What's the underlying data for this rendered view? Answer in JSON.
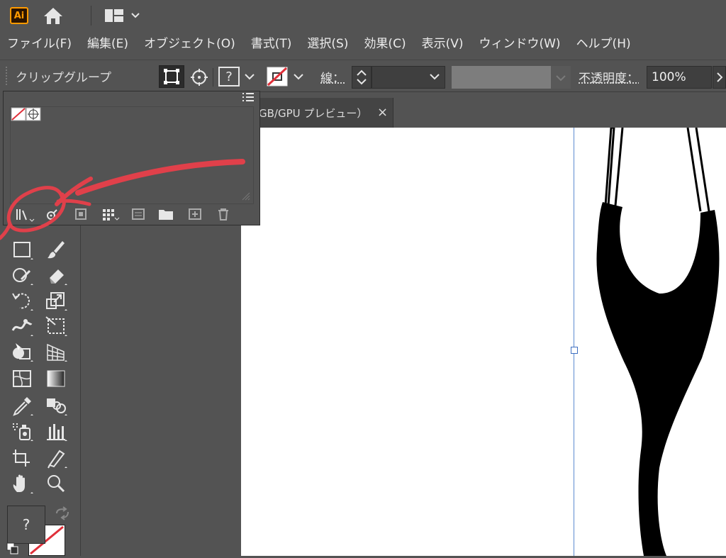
{
  "app": {
    "logo_text": "Ai",
    "accent": "#ff9a00"
  },
  "menu": {
    "items": [
      "ファイル(F)",
      "編集(E)",
      "オブジェクト(O)",
      "書式(T)",
      "選択(S)",
      "効果(C)",
      "表示(V)",
      "ウィンドウ(W)",
      "ヘルプ(H)"
    ]
  },
  "control": {
    "selection_label": "クリップグループ",
    "stroke_label": "線：",
    "opacity_label": "不透明度：",
    "opacity_value": "100%",
    "unknown_symbol": "?"
  },
  "document": {
    "tab_label": "GB/GPU プレビュー）",
    "close_symbol": "×"
  },
  "fill_panel": {
    "unknown_symbol": "?"
  },
  "annotation_color": "#e0404a",
  "guide_color": "#5d8bd1"
}
